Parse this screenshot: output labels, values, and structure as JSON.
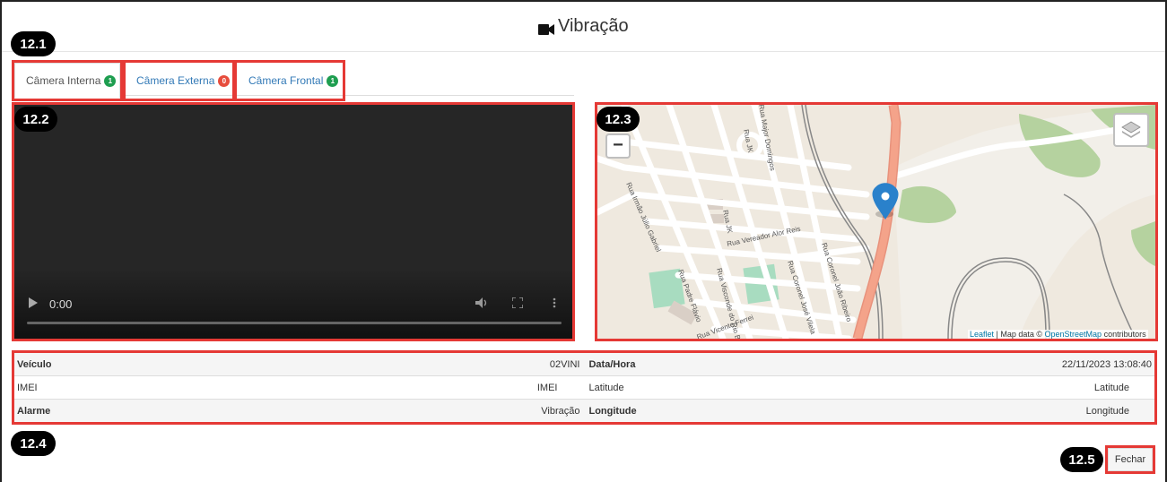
{
  "modal": {
    "title": "Vibração",
    "title_icon": "video-camera-icon"
  },
  "annotations": {
    "a1": "12.1",
    "a2": "12.2",
    "a3": "12.3",
    "a4": "12.4",
    "a5": "12.5"
  },
  "tabs": [
    {
      "label": "Câmera Interna",
      "count": "1",
      "badge_color": "#1e9e50",
      "active": true
    },
    {
      "label": "Câmera Externa",
      "count": "0",
      "badge_color": "#e74c3c",
      "active": false
    },
    {
      "label": "Câmera Frontal",
      "count": "1",
      "badge_color": "#1e9e50",
      "active": false
    }
  ],
  "video": {
    "time": "0:00",
    "progress": 0,
    "icons": [
      "play-icon",
      "volume-icon",
      "fullscreen-icon",
      "more-icon"
    ]
  },
  "map": {
    "zoom_out": "−",
    "streets": [
      "Rua Major Domingos",
      "Rua JK",
      "Rua JK",
      "Rua Irmão Júlio Gabriel",
      "Rua Vereador Alor Reis",
      "Rua Padre Flávio",
      "Rua Visconde do Rio Br",
      "Rua Coronel José Vilela",
      "Rua Coronel João Ribeiro",
      "Rua Vicente Ferrei"
    ],
    "attribution": {
      "leaflet": "Leaflet",
      "mid": " | Map data © ",
      "osm": "OpenStreetMap",
      "end": " contributors"
    },
    "marker_color": "#2a81cb"
  },
  "info": {
    "veiculo_label": "Veículo",
    "veiculo": "02VINI",
    "datahora_label": "Data/Hora",
    "datahora": "22/11/2023 13:08:40",
    "imei_label": "IMEI",
    "imei": "IMEI",
    "latitude_label": "Latitude",
    "latitude": "Latitude",
    "alarme_label": "Alarme",
    "alarme": "Vibração",
    "longitude_label": "Longitude",
    "longitude": "Longitude"
  },
  "footer": {
    "close_label": "Fechar"
  },
  "colors": {
    "highlight": "#e53935",
    "link": "#337ab7"
  }
}
